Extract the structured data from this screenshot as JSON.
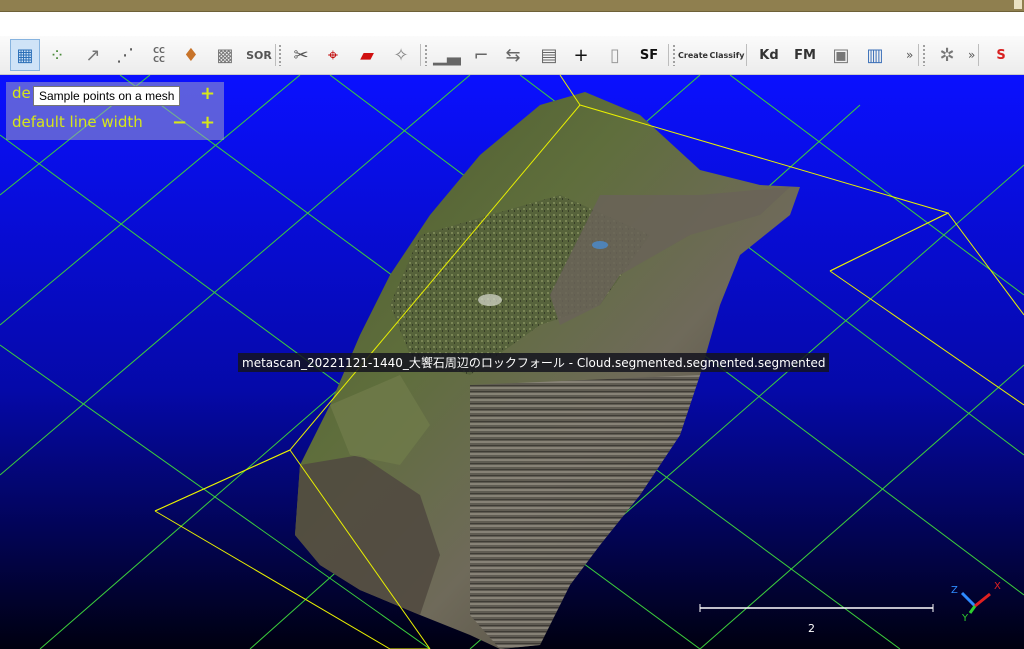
{
  "toolbar": {
    "buttons": [
      {
        "icon": "sample-points-icon",
        "glyph": "▦",
        "color": "#2a6fb8"
      },
      {
        "icon": "subsample-icon",
        "glyph": "⁘",
        "color": "#4a8a3a"
      },
      {
        "icon": "normals-icon",
        "glyph": "↗",
        "color": "#777777"
      },
      {
        "icon": "scatter-icon",
        "glyph": "⋰",
        "color": "#555555"
      },
      {
        "icon": "cc-icon",
        "text": "CC\nCC",
        "color": "#666666"
      },
      {
        "icon": "bell-icon",
        "glyph": "♦",
        "color": "#c8742a"
      },
      {
        "icon": "noise-icon",
        "glyph": "▩",
        "color": "#777777"
      },
      {
        "icon": "sor-icon",
        "text": "SOR",
        "color": "#555555"
      },
      {
        "icon": "scissors-icon",
        "glyph": "✂",
        "color": "#555555"
      },
      {
        "icon": "crosshair-icon",
        "glyph": "⌖",
        "color": "#c00000"
      },
      {
        "icon": "box-icon",
        "glyph": "▰",
        "color": "#d01010"
      },
      {
        "icon": "pick-icon",
        "glyph": "✧",
        "color": "#888888"
      },
      {
        "icon": "histogram-icon",
        "glyph": "▁▃",
        "color": "#666666"
      },
      {
        "icon": "stairs-icon",
        "glyph": "⌐",
        "color": "#666666"
      },
      {
        "icon": "dist-icon",
        "glyph": "⇆",
        "color": "#666666"
      },
      {
        "icon": "cube-icon",
        "glyph": "▤",
        "color": "#666666"
      },
      {
        "icon": "plus-icon",
        "glyph": "+",
        "color": "#111111"
      },
      {
        "icon": "page-icon",
        "glyph": "▯",
        "color": "#999999"
      },
      {
        "icon": "sf-icon",
        "text": "SF",
        "color": "#111111"
      },
      {
        "icon": "canupo-create-icon",
        "text": "Create",
        "color": "#333333"
      },
      {
        "icon": "canupo-classify-icon",
        "text": "Classify",
        "color": "#333333"
      },
      {
        "icon": "kd-icon",
        "text": "Kd",
        "color": "#333333"
      },
      {
        "icon": "fm-icon",
        "text": "FM",
        "color": "#333333"
      },
      {
        "icon": "disk-icon",
        "glyph": "▣",
        "color": "#777777"
      },
      {
        "icon": "csv-icon",
        "glyph": "▥",
        "color": "#3a6fb8"
      },
      {
        "icon": "puzzle-icon",
        "glyph": "✲",
        "color": "#777777"
      },
      {
        "icon": "s-icon",
        "text": "S",
        "color": "#d82020"
      }
    ],
    "more_label": "»"
  },
  "overlay": {
    "row1_label": "de",
    "row2_label": "default line width",
    "minus": "−",
    "plus": "+"
  },
  "tooltip": "Sample points on a mesh",
  "entity_label": "metascan_20221121-1440_大饗石周辺のロックフォール - Cloud.segmented.segmented.segmented",
  "scale": {
    "value": "2"
  },
  "axes": {
    "x": "X",
    "y": "Y",
    "z": "Z"
  },
  "colors": {
    "background_top": "#0a10ff",
    "background_bottom": "#000010",
    "bbox_line": "#e8f000",
    "grid_line": "#3ccf3c",
    "overlay_text": "#d6e61a"
  }
}
